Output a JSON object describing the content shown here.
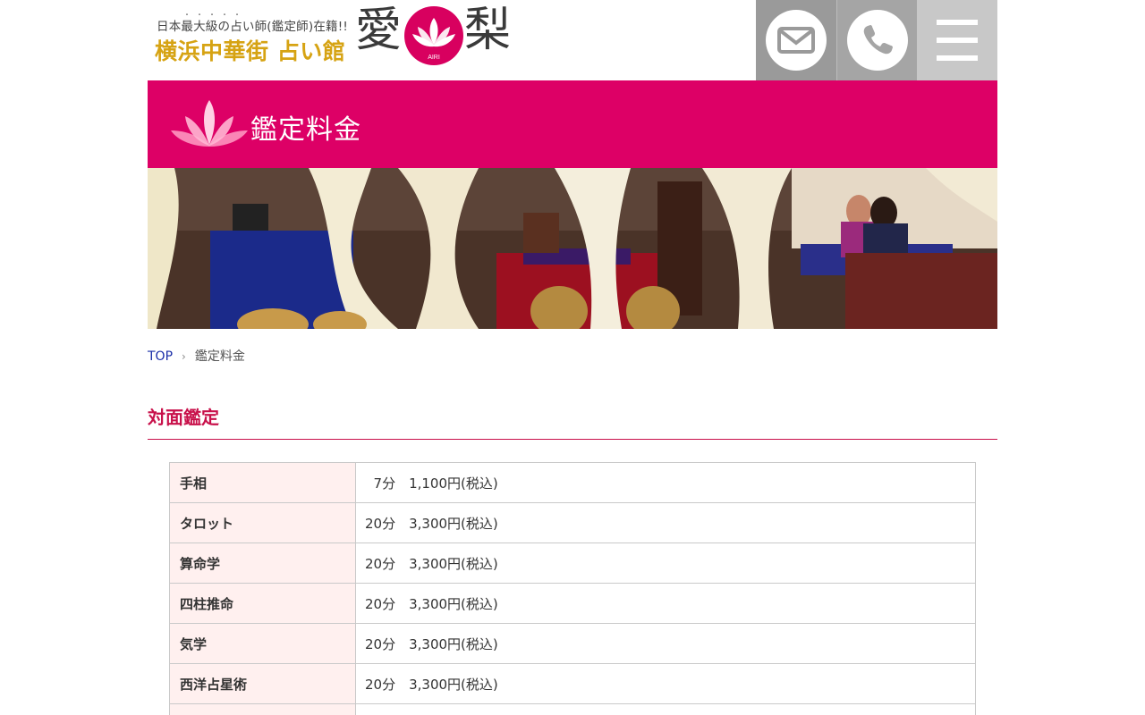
{
  "header": {
    "tagline": "日本最大級の占い師(鑑定師)在籍!!",
    "tagline_dots": "・・・・・",
    "shop_name": "横浜中華街 占い館",
    "logo_kanji_1": "愛",
    "logo_kanji_2": "梨",
    "logo_emblem_text": "AIRI",
    "buttons": [
      {
        "name": "mail",
        "icon": "mail-icon"
      },
      {
        "name": "tel",
        "icon": "phone-icon"
      },
      {
        "name": "menu",
        "icon": "hamburger-menu-icon"
      }
    ]
  },
  "title_band": {
    "title": "鑑定料金",
    "icon": "lotus-icon",
    "color": "#dd0066"
  },
  "breadcrumb": {
    "items": [
      "TOP",
      "鑑定料金"
    ]
  },
  "section": {
    "heading": "対面鑑定",
    "color": "#c8104a"
  },
  "price_rows": [
    {
      "label": "手相",
      "value": "  7分　1,100円(税込)"
    },
    {
      "label": "タロット",
      "value": "20分　3,300円(税込)"
    },
    {
      "label": "算命学",
      "value": "20分　3,300円(税込)"
    },
    {
      "label": "四柱推命",
      "value": "20分　3,300円(税込)"
    },
    {
      "label": "気学",
      "value": "20分　3,300円(税込)"
    },
    {
      "label": "西洋占星術",
      "value": "20分　3,300円(税込)"
    },
    {
      "label": "",
      "value": ""
    }
  ]
}
